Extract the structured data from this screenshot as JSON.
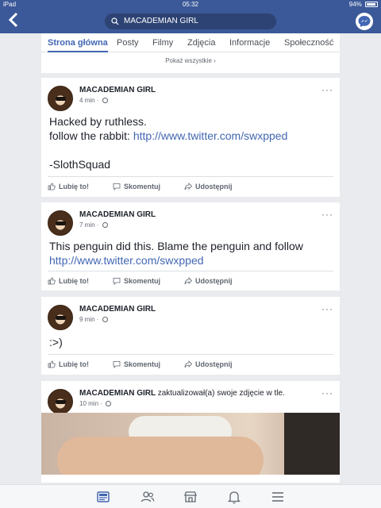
{
  "status_bar": {
    "device": "iPad",
    "time": "05:32",
    "battery": "94%"
  },
  "nav": {
    "back_icon": "chevron-left-icon",
    "search_value": "MACADEMIAN GIRL",
    "messenger_icon": "messenger-icon"
  },
  "tabs": {
    "items": [
      "Strona główna",
      "Posty",
      "Filmy",
      "Zdjęcia",
      "Informacje",
      "Społeczność"
    ],
    "active": "Strona główna",
    "show_all": "Pokaż wszystkie"
  },
  "posts": [
    {
      "author": "MACADEMIAN GIRL",
      "time": "4 min",
      "lines": [
        {
          "text": "Hacked by ruthless."
        },
        {
          "text": "follow the rabbit: ",
          "link": "http://www.twitter.com/swxpped"
        },
        {
          "text": ""
        },
        {
          "text": "-SlothSquad"
        }
      ]
    },
    {
      "author": "MACADEMIAN GIRL",
      "time": "7 min",
      "lines": [
        {
          "text": "This penguin did this. Blame the penguin and follow"
        },
        {
          "text": "",
          "link": "http://www.twitter.com/swxpped"
        }
      ]
    },
    {
      "author": "MACADEMIAN GIRL",
      "time": "9 min",
      "lines": [
        {
          "text": ":>)"
        }
      ]
    },
    {
      "author": "MACADEMIAN GIRL",
      "action": "zaktualizował(a) swoje zdjęcie w tle.",
      "time": "10 min"
    }
  ],
  "actions": {
    "like": "Lubię to!",
    "comment": "Skomentuj",
    "share": "Udostępnij"
  },
  "bottom_nav": {
    "icons": [
      "news-feed-icon",
      "friends-icon",
      "marketplace-icon",
      "notifications-icon",
      "menu-icon"
    ],
    "active": "news-feed-icon"
  },
  "colors": {
    "brand": "#3b5998",
    "link": "#4267b2",
    "background": "#e9ebee"
  }
}
